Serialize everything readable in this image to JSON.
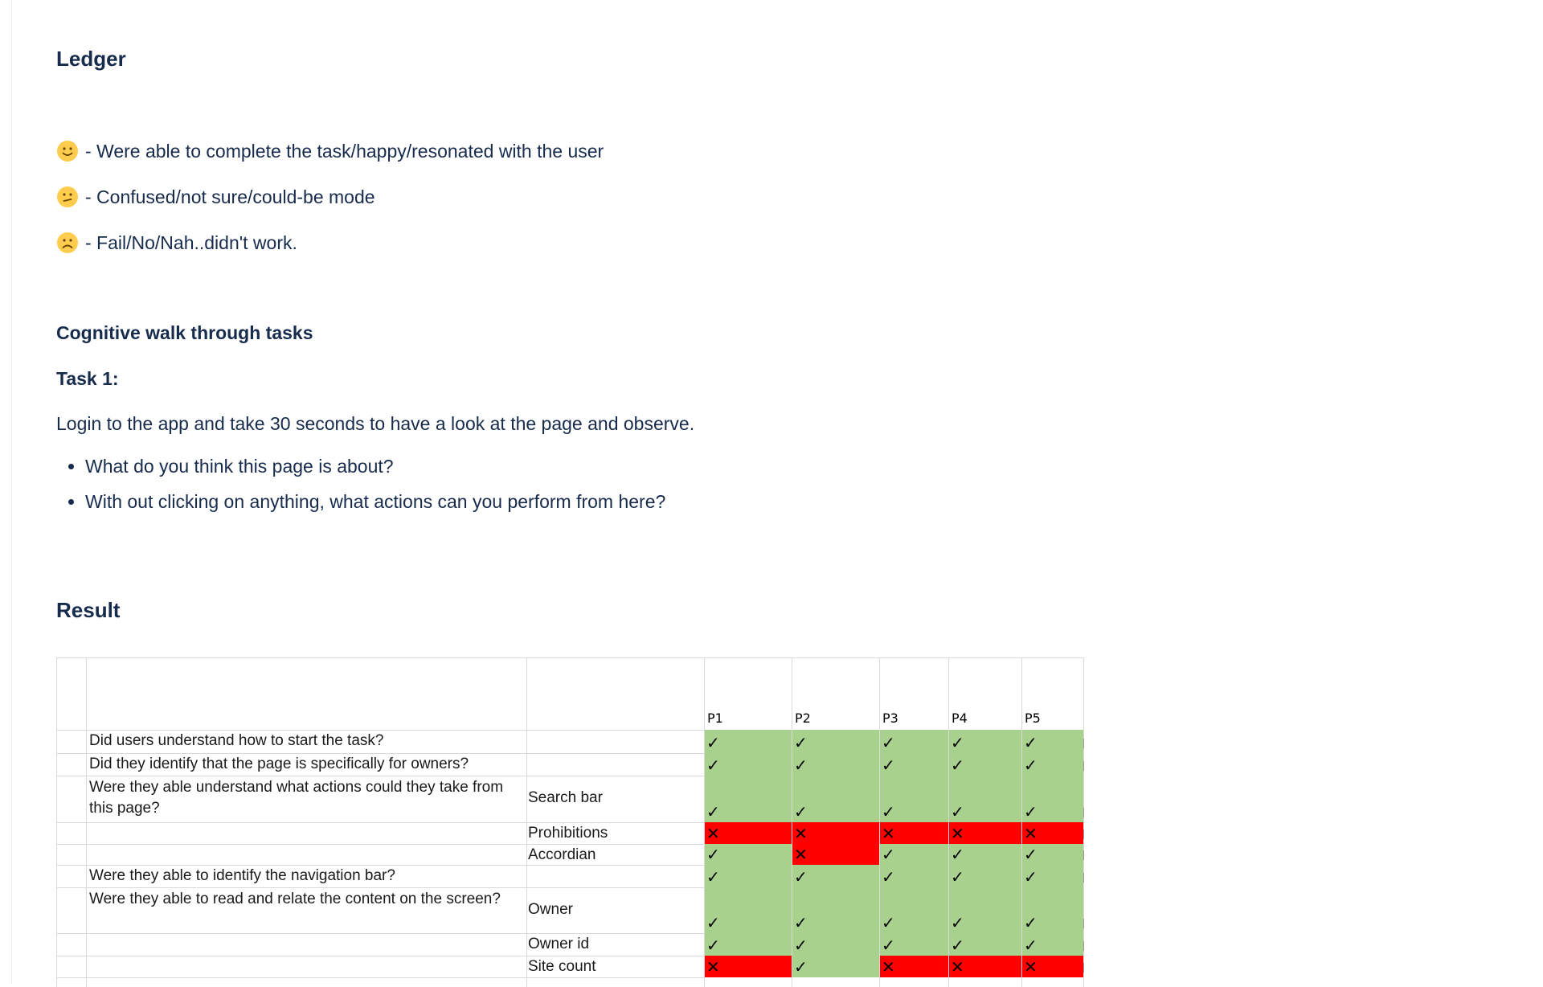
{
  "ledger": {
    "title": "Ledger",
    "items": [
      {
        "emoji": "slightly-smiling-face-icon",
        "text": "- Were able to complete the task/happy/resonated with the user"
      },
      {
        "emoji": "confused-face-icon",
        "text": "- Confused/not sure/could-be mode"
      },
      {
        "emoji": "frowning-face-icon",
        "text": "- Fail/No/Nah..didn't work."
      }
    ]
  },
  "tasks": {
    "title": "Cognitive walk through tasks",
    "task1_title": "Task 1:",
    "task1_desc": "Login to the app and take 30 seconds to have a look at the page and observe.",
    "questions": [
      "What do you think this page is about?",
      "With out clicking on anything, what actions can you perform from here?"
    ]
  },
  "result": {
    "title": "Result",
    "participants": [
      "P1",
      "P2",
      "P3",
      "P4",
      "P5"
    ],
    "rows": [
      {
        "question": "Did users understand how to start the task?",
        "sub": "",
        "marks": [
          "✓",
          "✓",
          "✓",
          "✓",
          "✓"
        ]
      },
      {
        "question": "Did they identify that the page is specifically for owners?",
        "sub": "",
        "marks": [
          "✓",
          "✓",
          "✓",
          "✓",
          "✓"
        ]
      },
      {
        "question": "Were they able understand what actions could they take from this page?",
        "sub": "Search bar",
        "marks": [
          "✓",
          "✓",
          "✓",
          "✓",
          "✓"
        ]
      },
      {
        "question": "",
        "sub": "Prohibitions",
        "marks": [
          "✕",
          "✕",
          "✕",
          "✕",
          "✕"
        ]
      },
      {
        "question": "",
        "sub": "Accordian",
        "marks": [
          "✓",
          "✕",
          "✓",
          "✓",
          "✓"
        ]
      },
      {
        "question": "Were they able to identify the navigation bar?",
        "sub": "",
        "marks": [
          "✓",
          "✓",
          "✓",
          "✓",
          "✓"
        ]
      },
      {
        "question": "Were they able to read and relate the content on the screen?",
        "sub": "Owner",
        "marks": [
          "✓",
          "✓",
          "✓",
          "✓",
          "✓"
        ]
      },
      {
        "question": "",
        "sub": "Owner id",
        "marks": [
          "✓",
          "✓",
          "✓",
          "✓",
          "✓"
        ]
      },
      {
        "question": "",
        "sub": "Site count",
        "marks": [
          "✕",
          "✓",
          "✕",
          "✕",
          "✕"
        ]
      }
    ],
    "colors": {
      "pass": "#a9d18e",
      "fail": "#ff0000"
    }
  }
}
